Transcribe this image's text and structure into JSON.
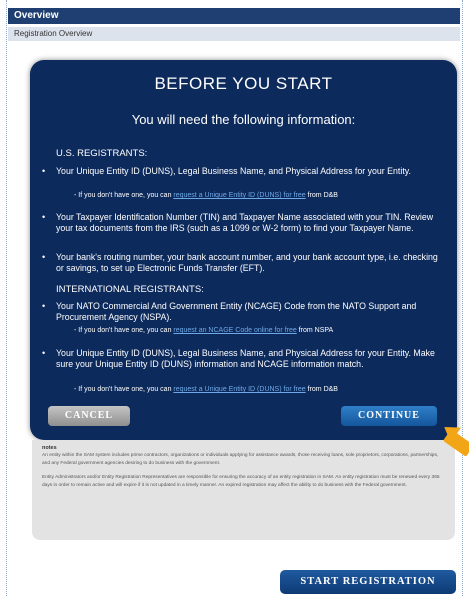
{
  "colors": {
    "header_bg": "#1f3f72",
    "modal_bg": "#0d2a5c",
    "link": "#6fa8e6",
    "arrow": "#f2a516",
    "continue_btn": "#1f6bb5"
  },
  "header": {
    "title": "Overview"
  },
  "subheader": {
    "label": "Registration Overview"
  },
  "modal": {
    "title": "BEFORE YOU START",
    "subtitle": "You will need the following information:",
    "us_label": "U.S. REGISTRANTS:",
    "items": [
      {
        "text": "Your Unique Entity ID (DUNS), Legal Business Name, and Physical Address for your Entity.",
        "sub_prefix": "- If you don't have one, you can ",
        "sub_link": "request a Unique Entity ID (DUNS) for free",
        "sub_suffix": " from D&B"
      },
      {
        "text": "Your Taxpayer Identification Number (TIN) and Taxpayer Name associated with your TIN. Review your tax documents from the IRS (such as a 1099 or W-2 form) to find your Taxpayer Name."
      },
      {
        "text": "Your bank's routing number, your bank account number, and your bank account type, i.e. checking or savings, to set up Electronic Funds Transfer (EFT)."
      }
    ],
    "intl_label": "INTERNATIONAL REGISTRANTS:",
    "intl_items": [
      {
        "text": "Your NATO Commercial And Government Entity (NCAGE) Code from the NATO Support and Procurement Agency (NSPA).",
        "sub_prefix": "- If you don't have one, you can ",
        "sub_link": "request an NCAGE Code online for free",
        "sub_suffix": " from NSPA"
      },
      {
        "text": "Your Unique Entity ID (DUNS), Legal Business Name, and Physical Address for your Entity. Make sure your Unique Entity ID (DUNS) information and NCAGE information match.",
        "sub_prefix": "- If you don't have one, you can ",
        "sub_link": "request a Unique Entity ID (DUNS) for free",
        "sub_suffix": " from D&B"
      }
    ],
    "cancel_label": "CANCEL",
    "continue_label": "CONTINUE"
  },
  "notes": {
    "title": "notes",
    "paragraphs": [
      "An entity within the SAM system includes prime contractors, organizations or individuals applying for assistance awards, those receiving loans, sole proprietors, corporations, partnerships, and any Federal government agencies desiring to do business with the government.",
      "Entity Administrators and/or Entity Registration Representatives are responsible for ensuring the accuracy of an entity registration in SAM. An entity registration must be renewed every 365 days in order to remain active and will expire if it is not updated in a timely manner. An expired registration may affect the ability to do business with the Federal government."
    ]
  },
  "start_registration_label": "START REGISTRATION"
}
